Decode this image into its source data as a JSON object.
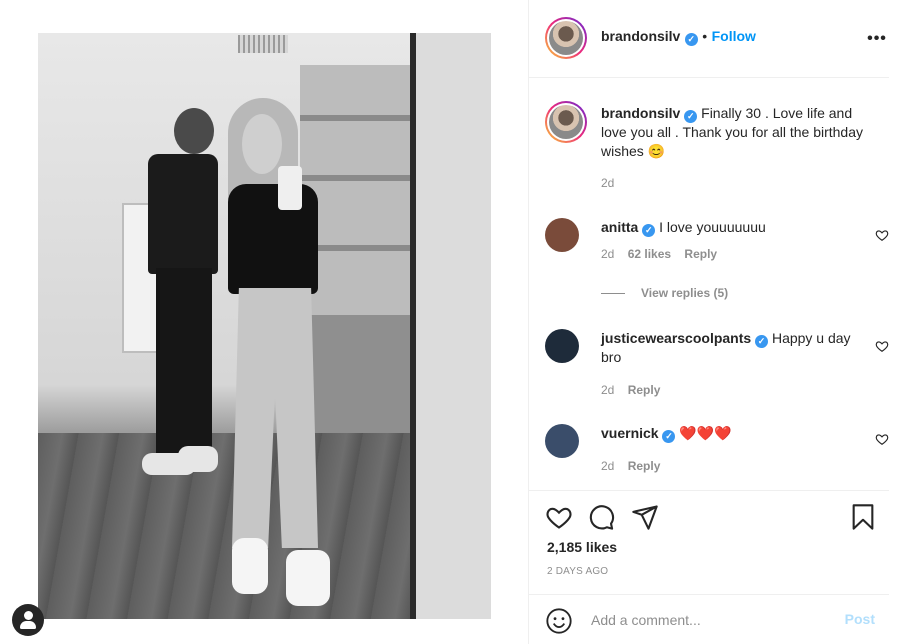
{
  "post": {
    "author": {
      "username": "brandonsilv",
      "verified_mark": "✓",
      "follow_label": "Follow",
      "separator": "•",
      "more_label": "•••"
    },
    "caption": {
      "username": "brandonsilv",
      "text": "Finally 30 . Love life and love you all . Thank you for all the birthday wishes 😊",
      "time": "2d"
    },
    "comments": [
      {
        "username": "anitta",
        "text": "I love youuuuuuu",
        "time": "2d",
        "likes": "62 likes",
        "reply_label": "Reply",
        "avatar_color": "#7a4b3a"
      },
      {
        "username": "justicewearscoolpants",
        "text": "Happy u day bro",
        "time": "2d",
        "reply_label": "Reply",
        "avatar_color": "#1e2b3a"
      },
      {
        "username": "vuernick",
        "text": "❤️❤️❤️",
        "time": "2d",
        "reply_label": "Reply",
        "avatar_color": "#3a4d6a"
      }
    ],
    "view_replies": "View replies (5)",
    "likes": "2,185 likes",
    "posted_ago": "2 DAYS AGO",
    "add_comment": {
      "placeholder": "Add a comment...",
      "post_label": "Post"
    },
    "icons": [
      "heart-icon",
      "comment-icon",
      "share-icon",
      "bookmark-icon",
      "emoji-icon",
      "user-tag-icon",
      "more-icon"
    ],
    "colors": {
      "accent": "#0095f6",
      "verified": "#3897f0",
      "post_disabled": "#b2dffc",
      "meta": "#8e8e8e",
      "text": "#262626"
    }
  }
}
